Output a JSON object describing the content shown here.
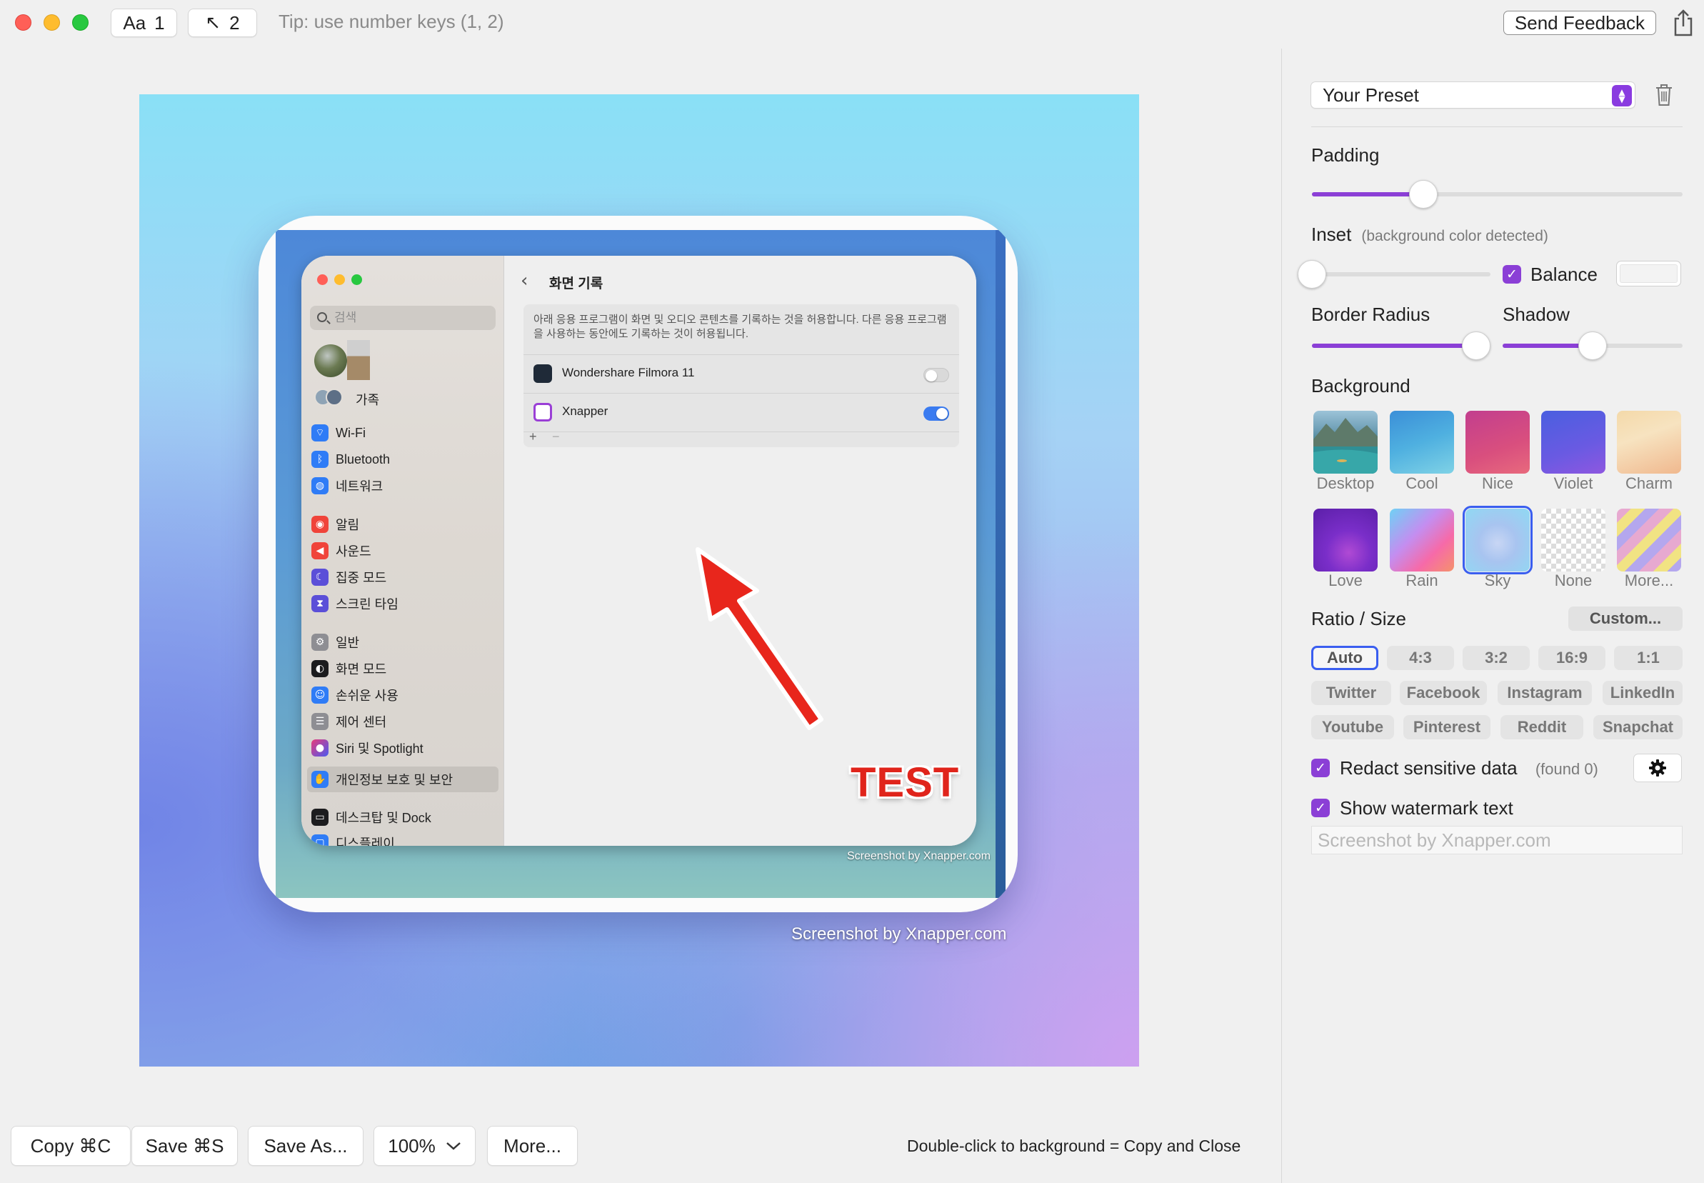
{
  "toolbar": {
    "mode1_glyph": "Aa",
    "mode1_key": "1",
    "mode2_glyph": "↖",
    "mode2_key": "2",
    "tip": "Tip: use number keys (1, 2)",
    "feedback": "Send Feedback"
  },
  "preview": {
    "window_title": "화면 기록",
    "search_placeholder": "검색",
    "family_label": "가족",
    "sidebar_items": [
      "Wi-Fi",
      "Bluetooth",
      "네트워크",
      "알림",
      "사운드",
      "집중 모드",
      "스크린 타임",
      "일반",
      "화면 모드",
      "손쉬운 사용",
      "제어 센터",
      "Siri 및 Spotlight",
      "개인정보 보호 및 보안",
      "데스크탑 및 Dock",
      "디스플레이"
    ],
    "permission_desc": "아래 응용 프로그램이 화면 및 오디오 콘텐츠를 기록하는 것을 허용합니다. 다른 응용 프로그램을 사용하는 동안에도 기록하는 것이 허용됩니다.",
    "apps": [
      {
        "name": "Wondershare Filmora 11",
        "enabled": false
      },
      {
        "name": "Xnapper",
        "enabled": true
      }
    ],
    "add_sign": "+",
    "remove_sign": "−",
    "inner_watermark": "Screenshot by Xnapper.com",
    "annotation_text": "TEST",
    "outer_watermark": "Screenshot by Xnapper.com"
  },
  "bottom": {
    "copy": "Copy ⌘C",
    "save": "Save ⌘S",
    "save_as": "Save As...",
    "zoom": "100%",
    "more": "More...",
    "hint": "Double-click to background = Copy and Close"
  },
  "panel": {
    "preset": "Your Preset",
    "padding_label": "Padding",
    "padding_value": 0.3,
    "inset_label": "Inset",
    "inset_note": "(background color detected)",
    "inset_value": 0.0,
    "balance_label": "Balance",
    "balance_checked": true,
    "border_radius_label": "Border Radius",
    "border_radius_value": 0.92,
    "shadow_label": "Shadow",
    "shadow_value": 0.5,
    "background_label": "Background",
    "backgrounds": [
      "Desktop",
      "Cool",
      "Nice",
      "Violet",
      "Charm",
      "Love",
      "Rain",
      "Sky",
      "None",
      "More..."
    ],
    "selected_background": "Sky",
    "ratio_label": "Ratio / Size",
    "custom": "Custom...",
    "ratios": [
      "Auto",
      "4:3",
      "3:2",
      "16:9",
      "1:1",
      "Twitter",
      "Facebook",
      "Instagram",
      "LinkedIn",
      "Youtube",
      "Pinterest",
      "Reddit",
      "Snapchat"
    ],
    "selected_ratio": "Auto",
    "redact_label": "Redact sensitive data",
    "redact_found": "(found 0)",
    "watermark_label": "Show watermark text",
    "watermark_placeholder": "Screenshot by Xnapper.com",
    "colors": {
      "accent": "#8b3fd6",
      "selection": "#3a5ef0"
    }
  }
}
